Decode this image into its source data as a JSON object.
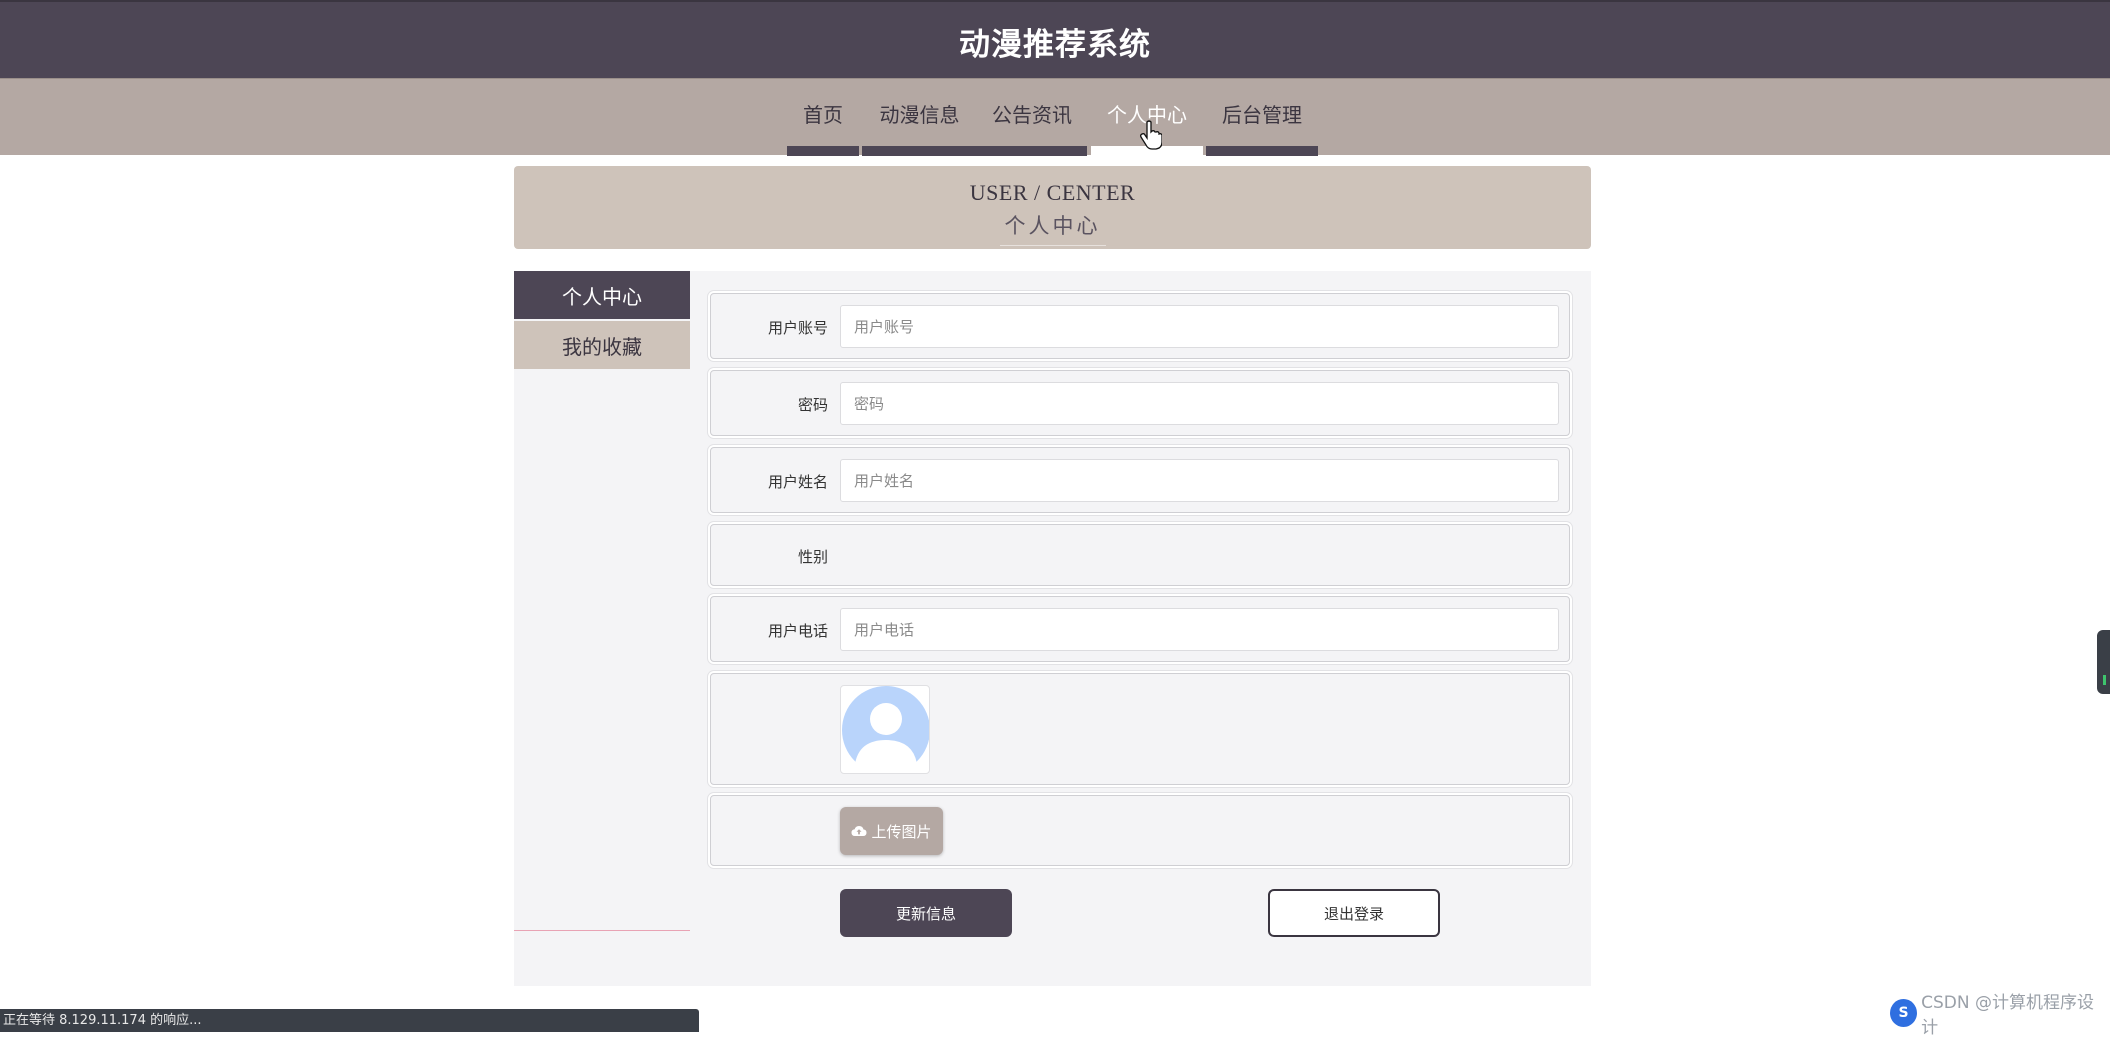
{
  "header": {
    "title": "动漫推荐系统"
  },
  "nav": {
    "items": [
      {
        "label": "首页",
        "active": false
      },
      {
        "label": "动漫信息",
        "active": false
      },
      {
        "label": "公告资讯",
        "active": false
      },
      {
        "label": "个人中心",
        "active": true
      },
      {
        "label": "后台管理",
        "active": false
      }
    ]
  },
  "banner": {
    "en": "USER / CENTER",
    "cn": "个人中心"
  },
  "sidebar": {
    "items": [
      {
        "label": "个人中心",
        "active": true
      },
      {
        "label": "我的收藏",
        "active": false
      }
    ]
  },
  "form": {
    "account": {
      "label": "用户账号",
      "placeholder": "用户账号",
      "value": ""
    },
    "password": {
      "label": "密码",
      "placeholder": "密码",
      "value": ""
    },
    "name": {
      "label": "用户姓名",
      "placeholder": "用户姓名",
      "value": ""
    },
    "gender": {
      "label": "性别"
    },
    "phone": {
      "label": "用户电话",
      "placeholder": "用户电话",
      "value": ""
    },
    "avatar": {
      "icon": "default-avatar-icon"
    },
    "upload": {
      "label": "上传图片",
      "icon": "cloud-upload-icon"
    }
  },
  "actions": {
    "update_label": "更新信息",
    "logout_label": "退出登录"
  },
  "statusbar": {
    "text": "正在等待 8.129.11.174 的响应..."
  },
  "watermark": {
    "logo": "S",
    "text": "CSDN @计算机程序设计"
  },
  "colors": {
    "primary_dark": "#4d4655",
    "nav_bg": "#b4a8a3",
    "banner_bg": "#cec3ba",
    "content_bg": "#f4f4f6",
    "avatar_blue": "#b9d4fb"
  }
}
